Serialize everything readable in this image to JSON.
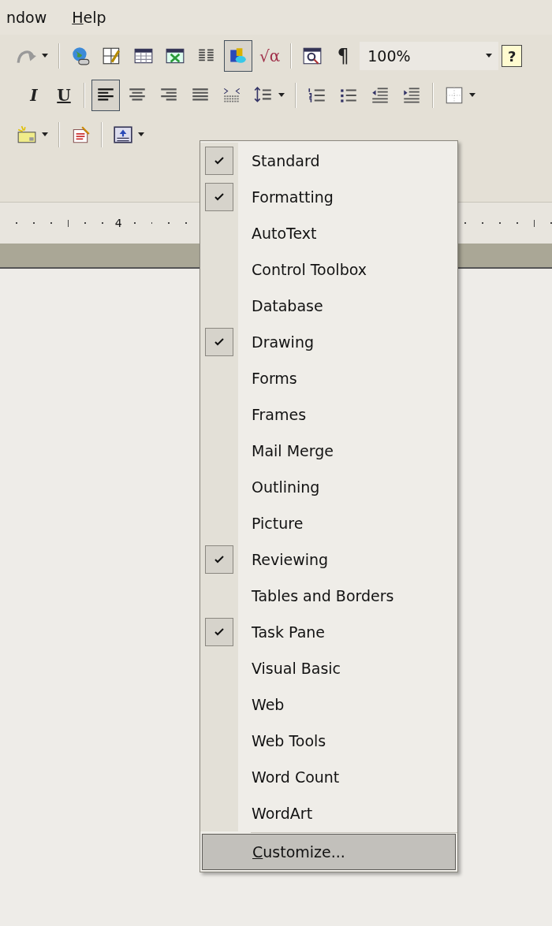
{
  "menu_bar": [
    {
      "label": "ndow",
      "underline_first": false
    },
    {
      "label": "Help",
      "underline_first": true
    }
  ],
  "toolbars": [
    {
      "items": [
        {
          "kind": "icon",
          "pressed": false,
          "dropdown": true
        },
        {
          "kind": "separator"
        },
        {
          "kind": "icon",
          "pressed": false,
          "dropdown": false
        },
        {
          "kind": "icon",
          "pressed": false,
          "dropdown": false
        },
        {
          "kind": "icon",
          "pressed": false,
          "dropdown": false
        },
        {
          "kind": "icon",
          "pressed": false,
          "dropdown": false
        },
        {
          "kind": "icon",
          "pressed": false,
          "dropdown": false
        },
        {
          "kind": "icon",
          "pressed": true,
          "dropdown": false
        },
        {
          "kind": "text",
          "text": "√α",
          "pressed": false
        },
        {
          "kind": "separator"
        },
        {
          "kind": "icon",
          "pressed": false,
          "dropdown": false
        },
        {
          "kind": "text",
          "text": "¶",
          "pressed": false
        },
        {
          "kind": "combo",
          "value": "100%"
        },
        {
          "kind": "text",
          "text": "?",
          "pressed": false
        }
      ]
    },
    {
      "items": [
        {
          "kind": "text",
          "text": "I",
          "pressed": false
        },
        {
          "kind": "text",
          "text": "U",
          "pressed": false
        },
        {
          "kind": "separator"
        },
        {
          "kind": "icon",
          "pressed": true,
          "dropdown": false
        },
        {
          "kind": "icon",
          "pressed": false,
          "dropdown": false
        },
        {
          "kind": "icon",
          "pressed": false,
          "dropdown": false
        },
        {
          "kind": "icon",
          "pressed": false,
          "dropdown": false
        },
        {
          "kind": "icon",
          "pressed": false,
          "dropdown": false
        },
        {
          "kind": "icon",
          "pressed": false,
          "dropdown": true
        },
        {
          "kind": "separator"
        },
        {
          "kind": "icon",
          "pressed": false,
          "dropdown": false
        },
        {
          "kind": "icon",
          "pressed": false,
          "dropdown": false
        },
        {
          "kind": "icon",
          "pressed": false,
          "dropdown": false
        },
        {
          "kind": "icon",
          "pressed": false,
          "dropdown": false
        },
        {
          "kind": "separator"
        },
        {
          "kind": "icon",
          "pressed": false,
          "dropdown": true
        }
      ]
    },
    {
      "items": [
        {
          "kind": "icon",
          "pressed": false,
          "dropdown": true
        },
        {
          "kind": "separator"
        },
        {
          "kind": "icon",
          "pressed": false,
          "dropdown": false
        },
        {
          "kind": "separator"
        },
        {
          "kind": "icon",
          "pressed": false,
          "dropdown": true
        }
      ]
    }
  ],
  "ruler": {
    "labels": [
      "4"
    ]
  },
  "context_menu": {
    "items": [
      {
        "label": "Standard",
        "checked": true
      },
      {
        "label": "Formatting",
        "checked": true
      },
      {
        "label": "AutoText",
        "checked": false
      },
      {
        "label": "Control Toolbox",
        "checked": false
      },
      {
        "label": "Database",
        "checked": false
      },
      {
        "label": "Drawing",
        "checked": true
      },
      {
        "label": "Forms",
        "checked": false
      },
      {
        "label": "Frames",
        "checked": false
      },
      {
        "label": "Mail Merge",
        "checked": false
      },
      {
        "label": "Outlining",
        "checked": false
      },
      {
        "label": "Picture",
        "checked": false
      },
      {
        "label": "Reviewing",
        "checked": true
      },
      {
        "label": "Tables and Borders",
        "checked": false
      },
      {
        "label": "Task Pane",
        "checked": true
      },
      {
        "label": "Visual Basic",
        "checked": false
      },
      {
        "label": "Web",
        "checked": false
      },
      {
        "label": "Web Tools",
        "checked": false
      },
      {
        "label": "Word Count",
        "checked": false
      },
      {
        "label": "WordArt",
        "checked": false
      }
    ],
    "footer": {
      "label": "Customize...",
      "underline_first": true,
      "selected": true
    }
  }
}
